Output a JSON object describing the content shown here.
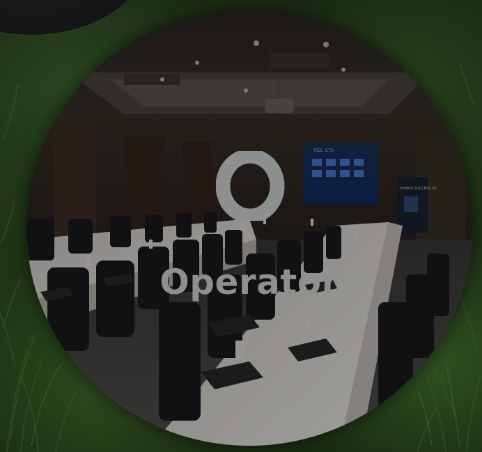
{
  "operator_card": {
    "label": "Operator",
    "icon": "operator-o-icon",
    "photo": "conference-room-photo"
  },
  "background": {
    "photo": "grass-photo"
  },
  "screen_slide": {
    "text": "REC STA"
  },
  "banner": {
    "text": "HYBRID SUCCESS SIT"
  },
  "colors": {
    "label": "#8e8f8f",
    "icon": "#8e8f8f",
    "tablecloth": "#e9e6e2",
    "chair": "#1b1b1d",
    "screen": "#1a4ea6"
  }
}
